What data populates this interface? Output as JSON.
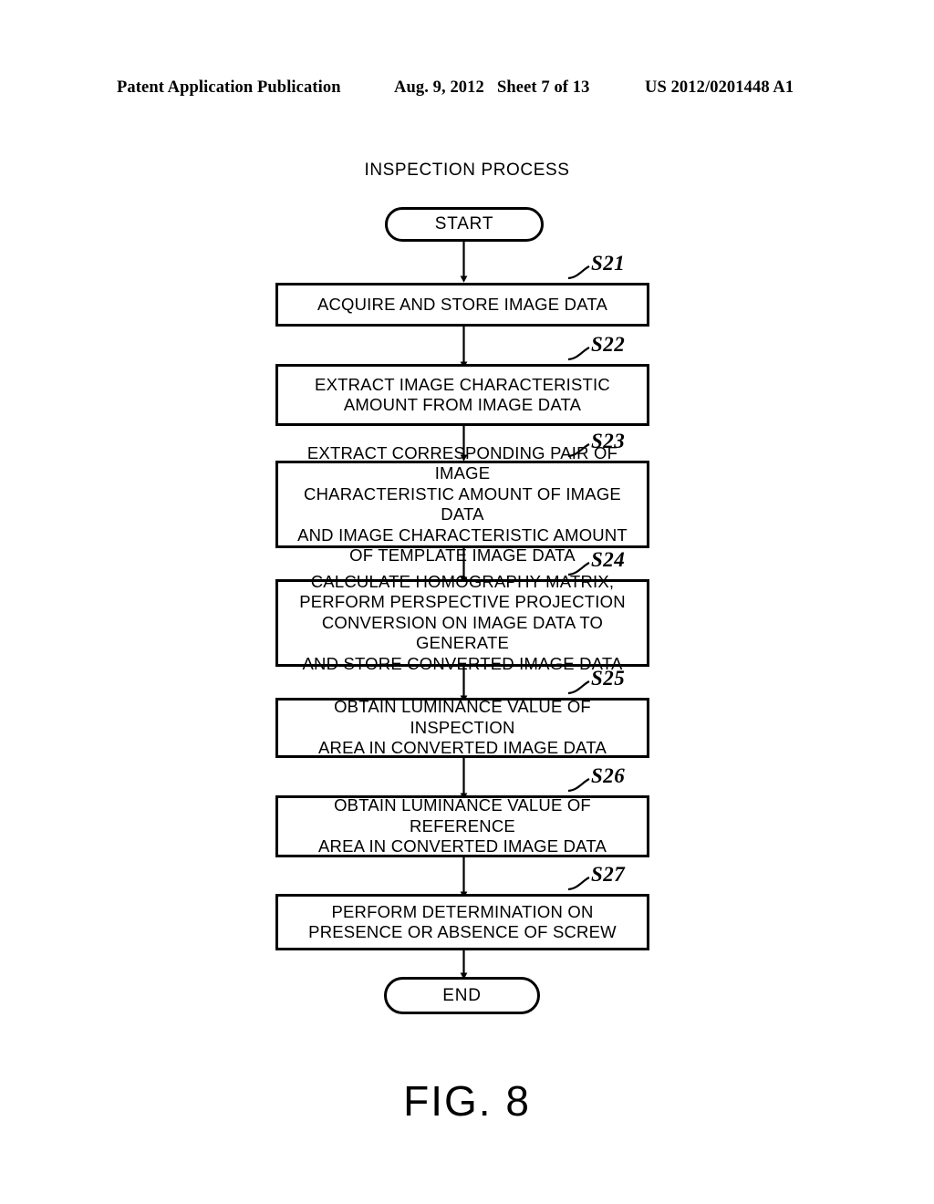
{
  "header": {
    "publication": "Patent Application Publication",
    "date": "Aug. 9, 2012",
    "sheet": "Sheet 7 of 13",
    "number": "US 2012/0201448 A1"
  },
  "figure": {
    "title": "INSPECTION PROCESS",
    "caption": "FIG. 8"
  },
  "flowchart": {
    "type": "flowchart",
    "orientation": "top-to-bottom",
    "start": {
      "label": "START"
    },
    "end": {
      "label": "END"
    },
    "steps": [
      {
        "ref": "S21",
        "text": "ACQUIRE AND STORE IMAGE DATA"
      },
      {
        "ref": "S22",
        "text": "EXTRACT IMAGE CHARACTERISTIC\nAMOUNT FROM IMAGE DATA"
      },
      {
        "ref": "S23",
        "text": "EXTRACT CORRESPONDING PAIR OF IMAGE\nCHARACTERISTIC AMOUNT OF IMAGE DATA\nAND IMAGE CHARACTERISTIC AMOUNT\nOF TEMPLATE IMAGE DATA"
      },
      {
        "ref": "S24",
        "text": "CALCULATE HOMOGRAPHY MATRIX,\nPERFORM PERSPECTIVE PROJECTION\nCONVERSION ON IMAGE DATA TO GENERATE\nAND STORE CONVERTED IMAGE DATA"
      },
      {
        "ref": "S25",
        "text": "OBTAIN LUMINANCE VALUE OF INSPECTION\nAREA IN CONVERTED IMAGE DATA"
      },
      {
        "ref": "S26",
        "text": "OBTAIN LUMINANCE VALUE OF REFERENCE\nAREA IN CONVERTED IMAGE DATA"
      },
      {
        "ref": "S27",
        "text": "PERFORM DETERMINATION ON\nPRESENCE OR ABSENCE OF SCREW"
      }
    ]
  },
  "colors": {
    "ink": "#000000",
    "paper": "#ffffff"
  }
}
